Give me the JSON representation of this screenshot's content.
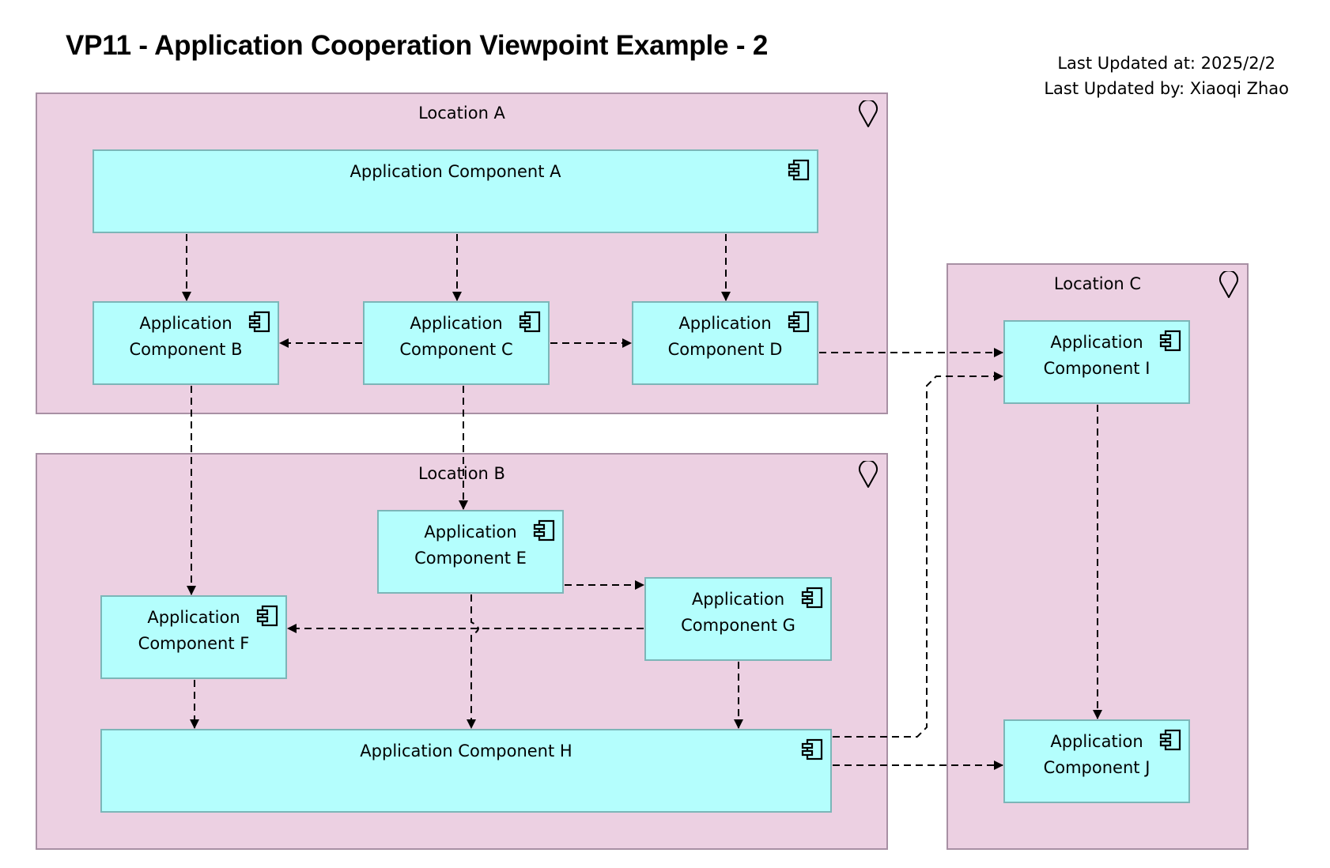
{
  "title": "VP11 - Application Cooperation Viewpoint Example - 2",
  "meta": {
    "last_updated_at": "Last Updated at: 2025/2/2",
    "last_updated_by": "Last Updated by: Xiaoqi Zhao"
  },
  "colors": {
    "location_fill": "#ecd0e2",
    "location_border": "#a890a4",
    "component_fill": "#b4fefd",
    "component_border": "#7cb6b8"
  },
  "locations": [
    {
      "id": "loc-a",
      "label": "Location A",
      "icon": "location-pin-icon"
    },
    {
      "id": "loc-b",
      "label": "Location B",
      "icon": "location-pin-icon"
    },
    {
      "id": "loc-c",
      "label": "Location C",
      "icon": "location-pin-icon"
    }
  ],
  "components": [
    {
      "id": "A",
      "label": "Application Component A",
      "location": "Location A",
      "icon": "application-component-icon"
    },
    {
      "id": "B",
      "label": "Application Component B",
      "location": "Location A",
      "icon": "application-component-icon"
    },
    {
      "id": "C",
      "label": "Application Component C",
      "location": "Location A",
      "icon": "application-component-icon"
    },
    {
      "id": "D",
      "label": "Application Component D",
      "location": "Location A",
      "icon": "application-component-icon"
    },
    {
      "id": "E",
      "label": "Application Component E",
      "location": "Location B",
      "icon": "application-component-icon"
    },
    {
      "id": "F",
      "label": "Application Component F",
      "location": "Location B",
      "icon": "application-component-icon"
    },
    {
      "id": "G",
      "label": "Application Component G",
      "location": "Location B",
      "icon": "application-component-icon"
    },
    {
      "id": "H",
      "label": "Application Component H",
      "location": "Location B",
      "icon": "application-component-icon"
    },
    {
      "id": "I",
      "label": "Application Component I",
      "location": "Location C",
      "icon": "application-component-icon"
    },
    {
      "id": "J",
      "label": "Application Component J",
      "location": "Location C",
      "icon": "application-component-icon"
    }
  ],
  "relations": [
    {
      "from": "A",
      "to": "B",
      "type": "flow"
    },
    {
      "from": "A",
      "to": "C",
      "type": "flow"
    },
    {
      "from": "A",
      "to": "D",
      "type": "flow"
    },
    {
      "from": "C",
      "to": "B",
      "type": "flow"
    },
    {
      "from": "C",
      "to": "D",
      "type": "flow"
    },
    {
      "from": "B",
      "to": "F",
      "type": "flow"
    },
    {
      "from": "C",
      "to": "E",
      "type": "flow"
    },
    {
      "from": "D",
      "to": "I",
      "type": "flow"
    },
    {
      "from": "E",
      "to": "G",
      "type": "flow"
    },
    {
      "from": "G",
      "to": "F",
      "type": "flow"
    },
    {
      "from": "E",
      "to": "H",
      "type": "flow"
    },
    {
      "from": "F",
      "to": "H",
      "type": "flow"
    },
    {
      "from": "G",
      "to": "H",
      "type": "flow"
    },
    {
      "from": "H",
      "to": "I",
      "type": "flow"
    },
    {
      "from": "H",
      "to": "J",
      "type": "flow"
    },
    {
      "from": "I",
      "to": "J",
      "type": "flow"
    }
  ]
}
